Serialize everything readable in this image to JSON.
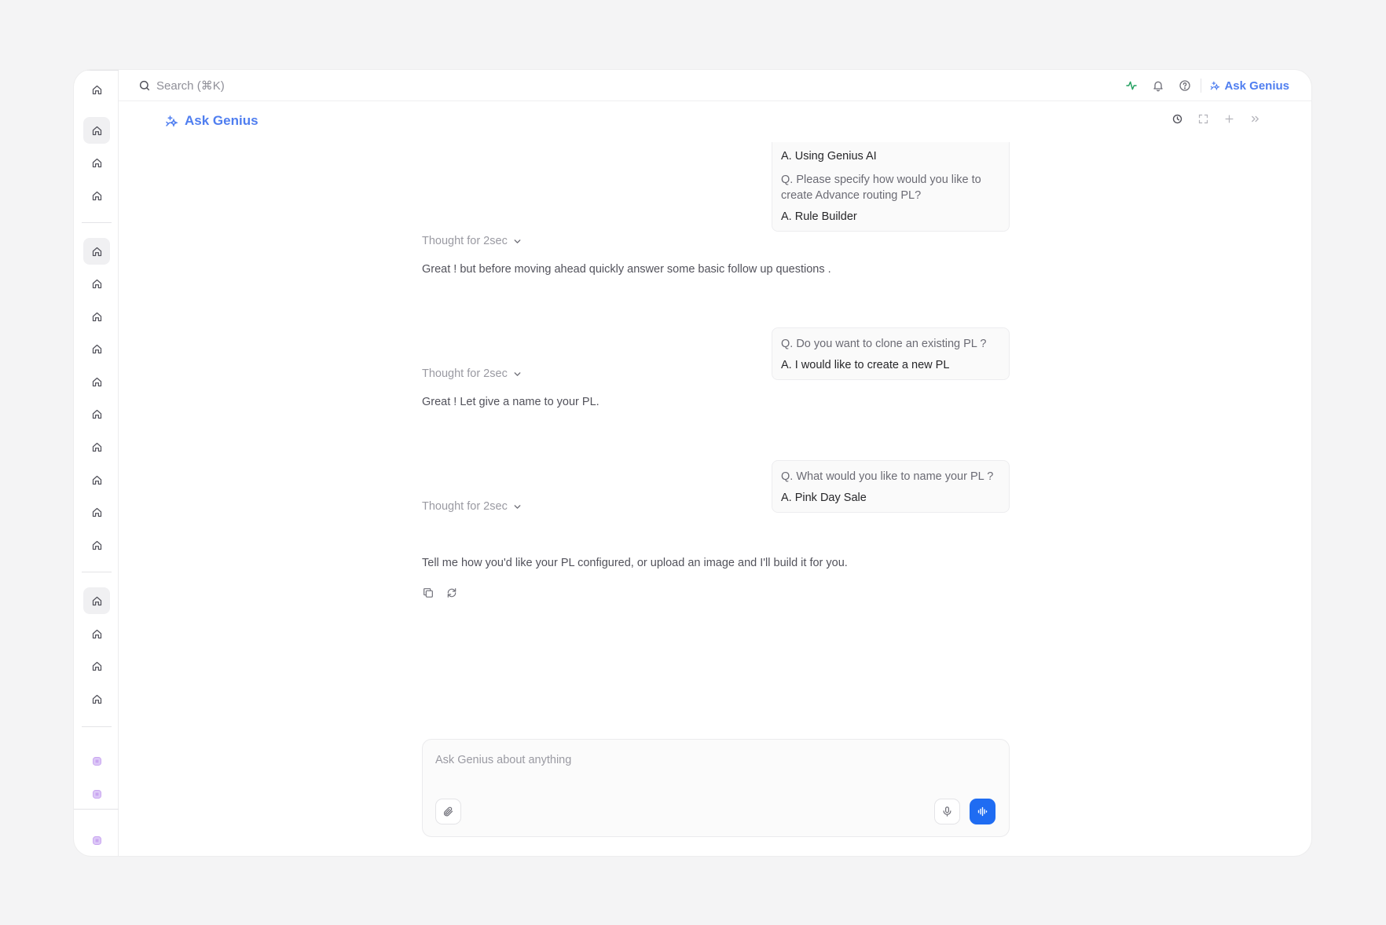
{
  "topbar": {
    "search_placeholder": "Search  (⌘K)",
    "ask_label": "Ask Genius"
  },
  "chat": {
    "title": "Ask Genius",
    "first_card": {
      "answer_prev": "A. Using Genius AI",
      "question": "Q. Please specify how would you like to create Advance routing PL?",
      "answer": "A. Rule Builder"
    },
    "thought_label": "Thought for 2sec",
    "messages": [
      "Great ! but before moving ahead quickly answer some basic follow up questions .",
      "Great ! Let give a name to your PL.",
      "Tell me how you'd like your PL configured, or upload an image and I'll build it for you."
    ],
    "cards": [
      {
        "question": "Q. Do you want to clone an existing PL ?",
        "answer": "A. I would like to create a new PL"
      },
      {
        "question": "Q. What would you like to name your PL ?",
        "answer": "A. Pink Day Sale"
      }
    ]
  },
  "composer": {
    "placeholder": "Ask Genius about anything"
  },
  "colors": {
    "accent": "#4f7ef0",
    "send": "#1f6cf2",
    "activity": "#22a060",
    "rail_bottom": "#c9a5f0"
  }
}
